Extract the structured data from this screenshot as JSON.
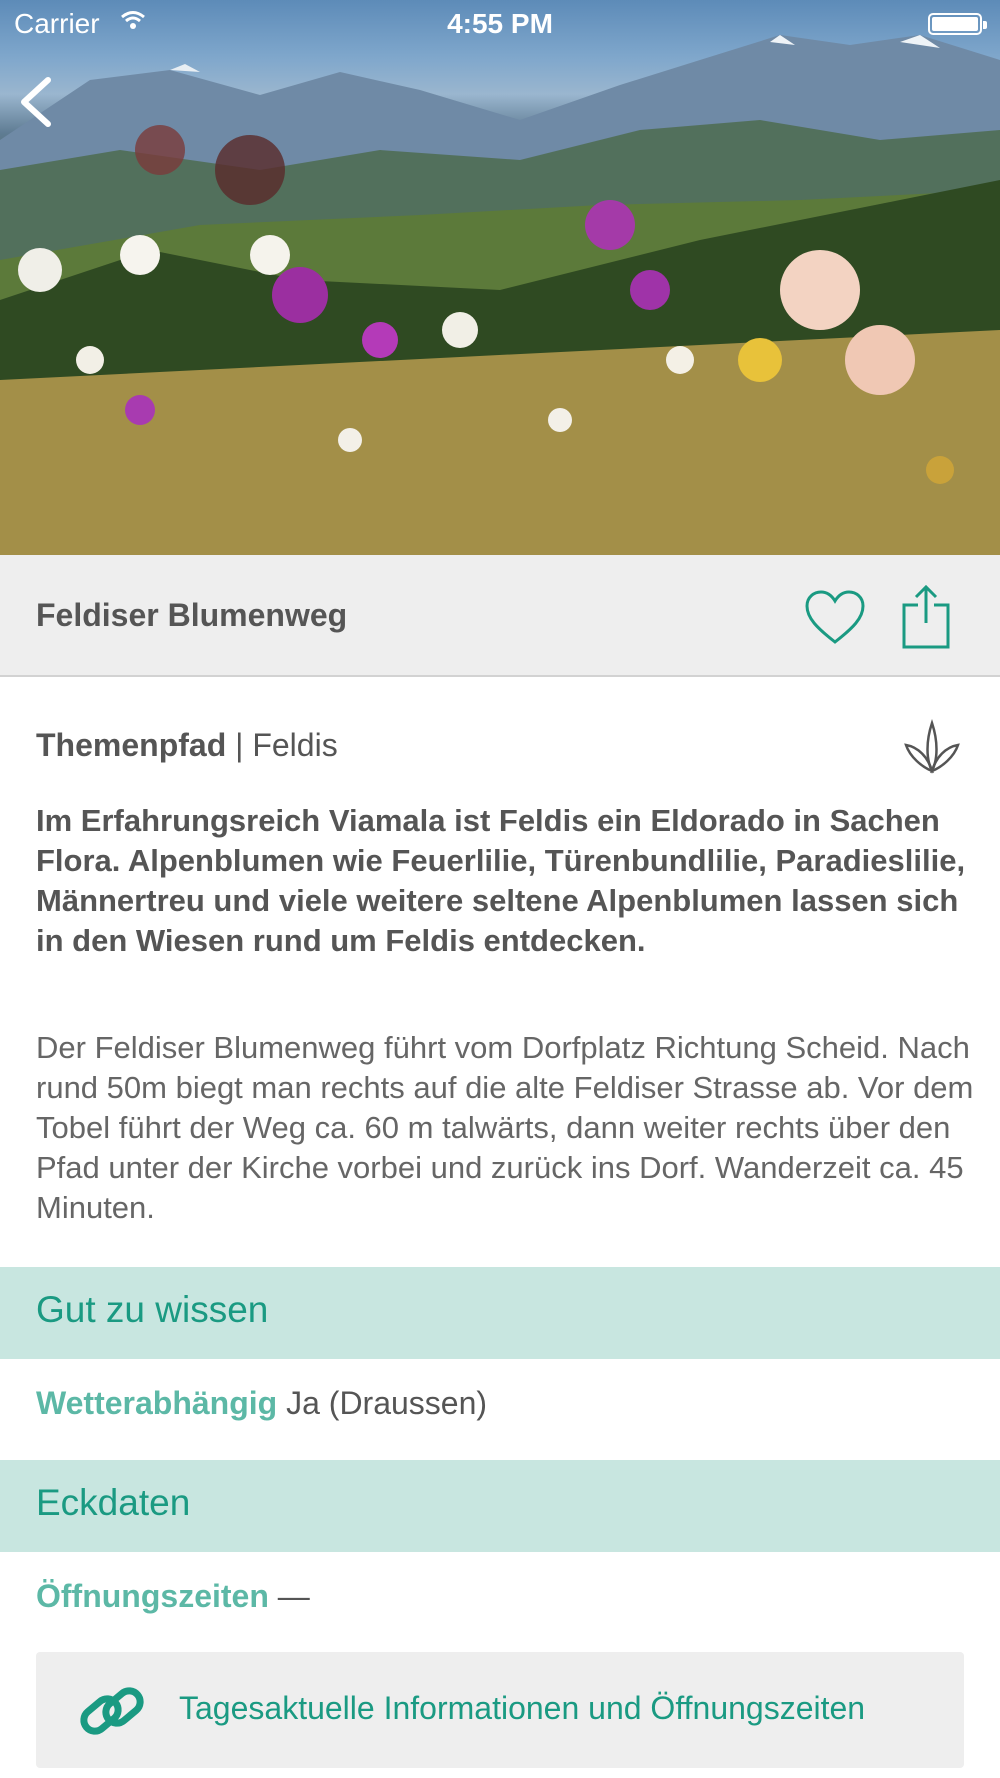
{
  "status_bar": {
    "carrier": "Carrier",
    "time": "4:55 PM"
  },
  "header": {
    "title": "Feldiser Blumenweg",
    "icons": [
      "back-chevron-icon",
      "heart-icon",
      "share-icon"
    ]
  },
  "meta": {
    "category": "Themenpfad",
    "separator": " | ",
    "location": "Feldis",
    "icon": "plant-leaf-icon"
  },
  "lead": "Im Erfahrungsreich Viamala ist Feldis ein Eldorado in Sachen Flora. Alpenblumen wie Feuerlilie, Türenbundlilie, Paradieslilie, Männertreu und viele weitere seltene Alpenblumen lassen sich in den Wiesen rund um Feldis entdecken.",
  "body": "Der Feldiser Blumenweg führt vom Dorfplatz Richtung Scheid. Nach rund 50m biegt man rechts auf die alte Feldiser Strasse ab. Vor dem Tobel führt der Weg ca. 60 m talwärts, dann weiter rechts über den Pfad unter der Kirche vorbei und zurück ins Dorf. Wanderzeit ca. 45 Minuten.",
  "good_to_know": {
    "header": "Gut zu wissen",
    "weather_key": "Wetterabhängig",
    "weather_value": "Ja (Draussen)"
  },
  "key_data": {
    "header": "Eckdaten",
    "opening_key": "Öffnungszeiten",
    "opening_value": "—"
  },
  "link": {
    "label": "Tagesaktuelle Informationen und Öffnungszeiten",
    "icon": "link-icon"
  },
  "colors": {
    "accent": "#1a9a82",
    "section_bg": "#c8e6e0",
    "key_text": "#5cb8a6"
  }
}
